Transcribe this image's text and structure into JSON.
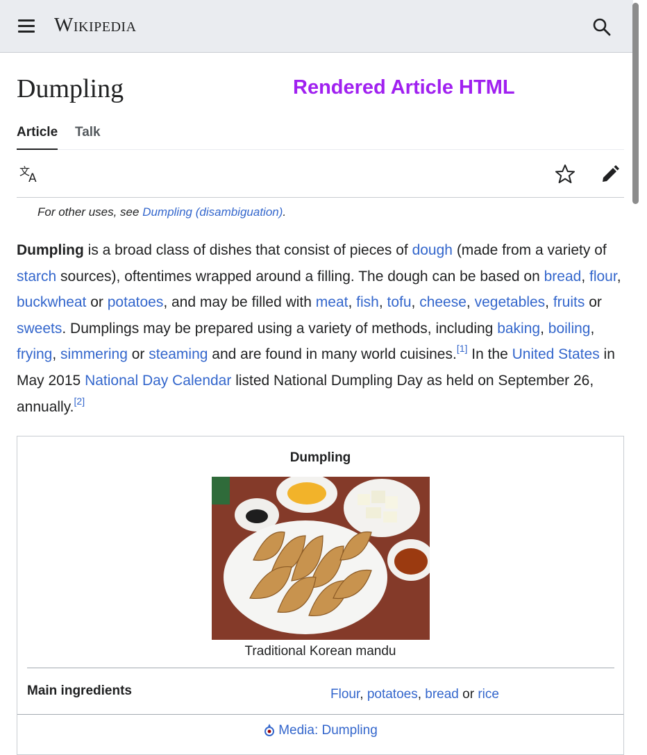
{
  "header": {
    "wordmark": "Wikipedia",
    "menu_icon": "hamburger-menu-icon",
    "search_icon": "search-icon",
    "background": "#eaecf0"
  },
  "overlay_label": "Rendered Article HTML",
  "page": {
    "title": "Dumpling"
  },
  "tabs": [
    {
      "label": "Article",
      "active": true
    },
    {
      "label": "Talk",
      "active": false
    }
  ],
  "toolbar": {
    "language_icon": "language-icon",
    "watch_icon": "star-icon",
    "edit_icon": "pencil-icon"
  },
  "hatnote": {
    "prefix": "For other uses, see ",
    "link": "Dumpling (disambiguation)",
    "suffix": "."
  },
  "lead": {
    "segments": [
      {
        "text": "Dumpling",
        "bold": true
      },
      {
        "text": " is a broad class of dishes that consist of pieces of "
      },
      {
        "text": "dough",
        "link": true
      },
      {
        "text": " (made from a variety of "
      },
      {
        "text": "starch",
        "link": true
      },
      {
        "text": " sources), oftentimes wrapped around a filling. The dough can be based on "
      },
      {
        "text": "bread",
        "link": true
      },
      {
        "text": ", "
      },
      {
        "text": "flour",
        "link": true
      },
      {
        "text": ", "
      },
      {
        "text": "buckwheat",
        "link": true
      },
      {
        "text": " or "
      },
      {
        "text": "potatoes",
        "link": true
      },
      {
        "text": ", and may be filled with "
      },
      {
        "text": "meat",
        "link": true
      },
      {
        "text": ", "
      },
      {
        "text": "fish",
        "link": true
      },
      {
        "text": ", "
      },
      {
        "text": "tofu",
        "link": true
      },
      {
        "text": ", "
      },
      {
        "text": "cheese",
        "link": true
      },
      {
        "text": ", "
      },
      {
        "text": "vegetables",
        "link": true
      },
      {
        "text": ", "
      },
      {
        "text": "fruits",
        "link": true
      },
      {
        "text": " or "
      },
      {
        "text": "sweets",
        "link": true
      },
      {
        "text": ". Dumplings may be prepared using a variety of methods, including "
      },
      {
        "text": "baking",
        "link": true
      },
      {
        "text": ", "
      },
      {
        "text": "boiling",
        "link": true
      },
      {
        "text": ", "
      },
      {
        "text": "frying",
        "link": true
      },
      {
        "text": ", "
      },
      {
        "text": "simmering",
        "link": true
      },
      {
        "text": " or "
      },
      {
        "text": "steaming",
        "link": true
      },
      {
        "text": " and are found in many world cuisines."
      },
      {
        "text": "[1]",
        "link": true,
        "sup": true
      },
      {
        "text": " In the "
      },
      {
        "text": "United States",
        "link": true
      },
      {
        "text": " in May 2015 "
      },
      {
        "text": "National Day Calendar",
        "link": true
      },
      {
        "text": " listed National Dumpling Day as held on September 26, annually."
      },
      {
        "text": "[2]",
        "link": true,
        "sup": true
      }
    ]
  },
  "infobox": {
    "title": "Dumpling",
    "caption": "Traditional Korean mandu",
    "row_label": "Main ingredients",
    "row_value": [
      {
        "text": "Flour",
        "link": true
      },
      {
        "text": ", "
      },
      {
        "text": "potatoes",
        "link": true
      },
      {
        "text": ", "
      },
      {
        "text": "bread",
        "link": true
      },
      {
        "text": " or "
      },
      {
        "text": "rice",
        "link": true
      }
    ],
    "media_link": "Media: Dumpling",
    "media_icon": "commons-icon"
  },
  "colors": {
    "link": "#3366cc",
    "text": "#202122",
    "overlay": "#a020f0"
  }
}
